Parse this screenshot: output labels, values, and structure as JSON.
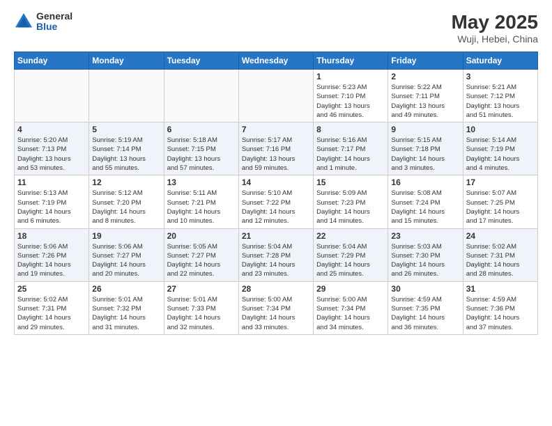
{
  "header": {
    "logo": {
      "general": "General",
      "blue": "Blue"
    },
    "title": "May 2025",
    "location": "Wuji, Hebei, China"
  },
  "days_of_week": [
    "Sunday",
    "Monday",
    "Tuesday",
    "Wednesday",
    "Thursday",
    "Friday",
    "Saturday"
  ],
  "weeks": [
    {
      "days": [
        {
          "number": "",
          "info": ""
        },
        {
          "number": "",
          "info": ""
        },
        {
          "number": "",
          "info": ""
        },
        {
          "number": "",
          "info": ""
        },
        {
          "number": "1",
          "info": "Sunrise: 5:23 AM\nSunset: 7:10 PM\nDaylight: 13 hours\nand 46 minutes."
        },
        {
          "number": "2",
          "info": "Sunrise: 5:22 AM\nSunset: 7:11 PM\nDaylight: 13 hours\nand 49 minutes."
        },
        {
          "number": "3",
          "info": "Sunrise: 5:21 AM\nSunset: 7:12 PM\nDaylight: 13 hours\nand 51 minutes."
        }
      ]
    },
    {
      "days": [
        {
          "number": "4",
          "info": "Sunrise: 5:20 AM\nSunset: 7:13 PM\nDaylight: 13 hours\nand 53 minutes."
        },
        {
          "number": "5",
          "info": "Sunrise: 5:19 AM\nSunset: 7:14 PM\nDaylight: 13 hours\nand 55 minutes."
        },
        {
          "number": "6",
          "info": "Sunrise: 5:18 AM\nSunset: 7:15 PM\nDaylight: 13 hours\nand 57 minutes."
        },
        {
          "number": "7",
          "info": "Sunrise: 5:17 AM\nSunset: 7:16 PM\nDaylight: 13 hours\nand 59 minutes."
        },
        {
          "number": "8",
          "info": "Sunrise: 5:16 AM\nSunset: 7:17 PM\nDaylight: 14 hours\nand 1 minute."
        },
        {
          "number": "9",
          "info": "Sunrise: 5:15 AM\nSunset: 7:18 PM\nDaylight: 14 hours\nand 3 minutes."
        },
        {
          "number": "10",
          "info": "Sunrise: 5:14 AM\nSunset: 7:19 PM\nDaylight: 14 hours\nand 4 minutes."
        }
      ]
    },
    {
      "days": [
        {
          "number": "11",
          "info": "Sunrise: 5:13 AM\nSunset: 7:19 PM\nDaylight: 14 hours\nand 6 minutes."
        },
        {
          "number": "12",
          "info": "Sunrise: 5:12 AM\nSunset: 7:20 PM\nDaylight: 14 hours\nand 8 minutes."
        },
        {
          "number": "13",
          "info": "Sunrise: 5:11 AM\nSunset: 7:21 PM\nDaylight: 14 hours\nand 10 minutes."
        },
        {
          "number": "14",
          "info": "Sunrise: 5:10 AM\nSunset: 7:22 PM\nDaylight: 14 hours\nand 12 minutes."
        },
        {
          "number": "15",
          "info": "Sunrise: 5:09 AM\nSunset: 7:23 PM\nDaylight: 14 hours\nand 14 minutes."
        },
        {
          "number": "16",
          "info": "Sunrise: 5:08 AM\nSunset: 7:24 PM\nDaylight: 14 hours\nand 15 minutes."
        },
        {
          "number": "17",
          "info": "Sunrise: 5:07 AM\nSunset: 7:25 PM\nDaylight: 14 hours\nand 17 minutes."
        }
      ]
    },
    {
      "days": [
        {
          "number": "18",
          "info": "Sunrise: 5:06 AM\nSunset: 7:26 PM\nDaylight: 14 hours\nand 19 minutes."
        },
        {
          "number": "19",
          "info": "Sunrise: 5:06 AM\nSunset: 7:27 PM\nDaylight: 14 hours\nand 20 minutes."
        },
        {
          "number": "20",
          "info": "Sunrise: 5:05 AM\nSunset: 7:27 PM\nDaylight: 14 hours\nand 22 minutes."
        },
        {
          "number": "21",
          "info": "Sunrise: 5:04 AM\nSunset: 7:28 PM\nDaylight: 14 hours\nand 23 minutes."
        },
        {
          "number": "22",
          "info": "Sunrise: 5:04 AM\nSunset: 7:29 PM\nDaylight: 14 hours\nand 25 minutes."
        },
        {
          "number": "23",
          "info": "Sunrise: 5:03 AM\nSunset: 7:30 PM\nDaylight: 14 hours\nand 26 minutes."
        },
        {
          "number": "24",
          "info": "Sunrise: 5:02 AM\nSunset: 7:31 PM\nDaylight: 14 hours\nand 28 minutes."
        }
      ]
    },
    {
      "days": [
        {
          "number": "25",
          "info": "Sunrise: 5:02 AM\nSunset: 7:31 PM\nDaylight: 14 hours\nand 29 minutes."
        },
        {
          "number": "26",
          "info": "Sunrise: 5:01 AM\nSunset: 7:32 PM\nDaylight: 14 hours\nand 31 minutes."
        },
        {
          "number": "27",
          "info": "Sunrise: 5:01 AM\nSunset: 7:33 PM\nDaylight: 14 hours\nand 32 minutes."
        },
        {
          "number": "28",
          "info": "Sunrise: 5:00 AM\nSunset: 7:34 PM\nDaylight: 14 hours\nand 33 minutes."
        },
        {
          "number": "29",
          "info": "Sunrise: 5:00 AM\nSunset: 7:34 PM\nDaylight: 14 hours\nand 34 minutes."
        },
        {
          "number": "30",
          "info": "Sunrise: 4:59 AM\nSunset: 7:35 PM\nDaylight: 14 hours\nand 36 minutes."
        },
        {
          "number": "31",
          "info": "Sunrise: 4:59 AM\nSunset: 7:36 PM\nDaylight: 14 hours\nand 37 minutes."
        }
      ]
    }
  ]
}
